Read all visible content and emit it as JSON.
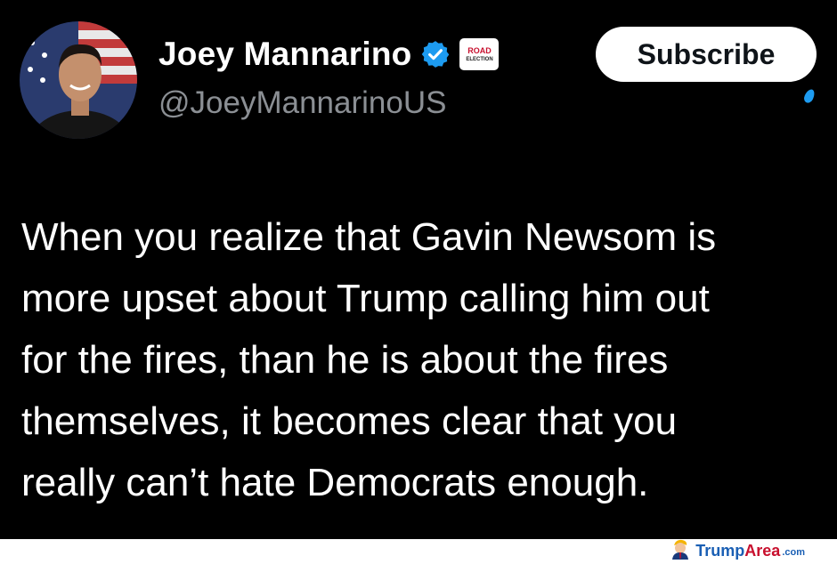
{
  "tweet": {
    "display_name": "Joey Mannarino",
    "handle": "@JoeyMannarinoUS",
    "affiliate_badge": {
      "line1": "ROAD",
      "line2": "ELECTION"
    },
    "subscribe_label": "Subscribe",
    "text": "When you realize that Gavin Newsom is\nmore upset about Trump calling him out\nfor the fires, than he is about the fires\nthemselves, it becomes clear that you\nreally can’t hate Democrats enough."
  },
  "watermark": {
    "trump": "Trump",
    "area": "Area",
    "com": ".com"
  },
  "icons": {
    "avatar": "profile-photo",
    "verified": "verified-badge-icon",
    "affiliate": "affiliate-badge-icon",
    "mascot": "trump-mascot-icon"
  },
  "colors": {
    "background": "#000000",
    "text": "#ffffff",
    "handle": "#8b8f94",
    "verified": "#1d9bf0",
    "watermark_blue": "#1a5fb4",
    "watermark_red": "#c8102e"
  }
}
